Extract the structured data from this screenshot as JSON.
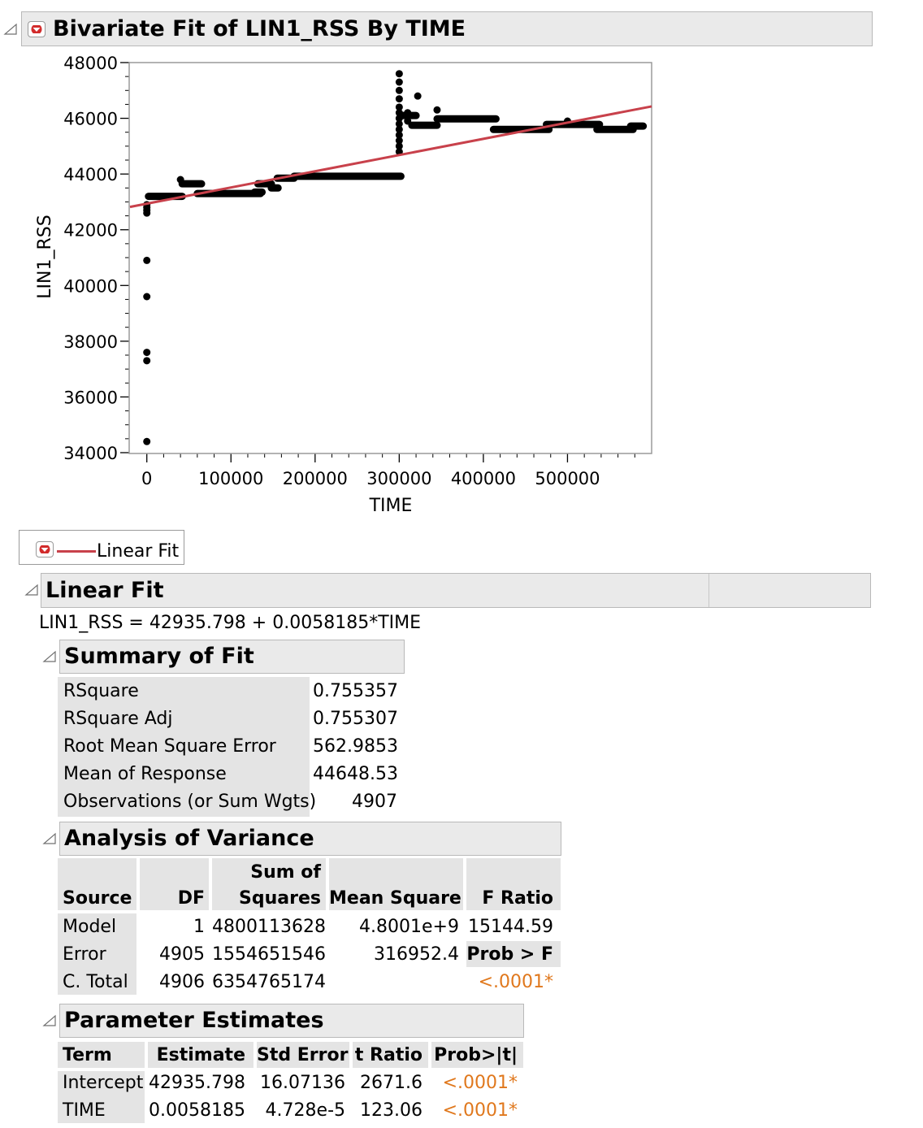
{
  "report": {
    "title": "Bivariate Fit of LIN1_RSS By TIME"
  },
  "chart_data": {
    "type": "scatter",
    "xlabel": "TIME",
    "ylabel": "LIN1_RSS",
    "xlim": [
      -20000,
      600000
    ],
    "ylim": [
      34000,
      48000
    ],
    "x_ticks": [
      "0",
      "100000",
      "200000",
      "300000",
      "400000",
      "500000"
    ],
    "y_ticks": [
      "34000",
      "36000",
      "38000",
      "40000",
      "42000",
      "44000",
      "46000",
      "48000"
    ],
    "fit_line": {
      "name": "Linear Fit",
      "intercept": 42935.798,
      "slope": 0.0058185,
      "color": "#c8414b"
    },
    "point_color": "#000000",
    "outlier_points": [
      {
        "x": 0,
        "y": 34400
      },
      {
        "x": 0,
        "y": 37300
      },
      {
        "x": 0,
        "y": 37600
      },
      {
        "x": 0,
        "y": 39600
      },
      {
        "x": 0,
        "y": 40900
      },
      {
        "x": 0,
        "y": 42600
      },
      {
        "x": 0,
        "y": 42700
      },
      {
        "x": 0,
        "y": 42800
      },
      {
        "x": 0,
        "y": 42900
      },
      {
        "x": 40000,
        "y": 43800
      },
      {
        "x": 300000,
        "y": 44800
      },
      {
        "x": 300000,
        "y": 45000
      },
      {
        "x": 300000,
        "y": 45200
      },
      {
        "x": 300000,
        "y": 45400
      },
      {
        "x": 300000,
        "y": 45600
      },
      {
        "x": 300000,
        "y": 45800
      },
      {
        "x": 300000,
        "y": 46000
      },
      {
        "x": 300000,
        "y": 46200
      },
      {
        "x": 300000,
        "y": 46400
      },
      {
        "x": 300000,
        "y": 46700
      },
      {
        "x": 300000,
        "y": 47000
      },
      {
        "x": 300000,
        "y": 47300
      },
      {
        "x": 300000,
        "y": 47600
      },
      {
        "x": 310000,
        "y": 46200
      },
      {
        "x": 310000,
        "y": 45900
      },
      {
        "x": 322000,
        "y": 46800
      },
      {
        "x": 345000,
        "y": 46300
      },
      {
        "x": 500000,
        "y": 45900
      }
    ],
    "segments": [
      {
        "x0": 2000,
        "x1": 42000,
        "y": 43200
      },
      {
        "x0": 42000,
        "x1": 65000,
        "y": 43650
      },
      {
        "x0": 60000,
        "x1": 135000,
        "y": 43300
      },
      {
        "x0": 128000,
        "x1": 137000,
        "y": 43350
      },
      {
        "x0": 132000,
        "x1": 148000,
        "y": 43650
      },
      {
        "x0": 148000,
        "x1": 156000,
        "y": 43500
      },
      {
        "x0": 155000,
        "x1": 175000,
        "y": 43850
      },
      {
        "x0": 175000,
        "x1": 302000,
        "y": 43920
      },
      {
        "x0": 302000,
        "x1": 320000,
        "y": 46100
      },
      {
        "x0": 315000,
        "x1": 345000,
        "y": 45750
      },
      {
        "x0": 345000,
        "x1": 415000,
        "y": 45980
      },
      {
        "x0": 412000,
        "x1": 478000,
        "y": 45600
      },
      {
        "x0": 475000,
        "x1": 538000,
        "y": 45780
      },
      {
        "x0": 535000,
        "x1": 578000,
        "y": 45600
      },
      {
        "x0": 575000,
        "x1": 590000,
        "y": 45720
      }
    ]
  },
  "legend": {
    "label": "Linear Fit"
  },
  "linear_fit": {
    "title": "Linear Fit",
    "equation": "LIN1_RSS = 42935.798 + 0.0058185*TIME"
  },
  "summary": {
    "title": "Summary of Fit",
    "rows": [
      {
        "label": "RSquare",
        "value": "0.755357"
      },
      {
        "label": "RSquare Adj",
        "value": "0.755307"
      },
      {
        "label": "Root Mean Square Error",
        "value": "562.9853"
      },
      {
        "label": "Mean of Response",
        "value": "44648.53"
      },
      {
        "label": "Observations (or Sum Wgts)",
        "value": "4907"
      }
    ]
  },
  "anova": {
    "title": "Analysis of Variance",
    "headers": {
      "source": "Source",
      "df": "DF",
      "ss_top": "Sum of",
      "ss_bottom": "Squares",
      "ms": "Mean Square",
      "f": "F Ratio",
      "prob": "Prob > F"
    },
    "rows": [
      {
        "source": "Model",
        "df": "1",
        "ss": "4800113628",
        "ms": "4.8001e+9",
        "extra": "15144.59"
      },
      {
        "source": "Error",
        "df": "4905",
        "ss": "1554651546",
        "ms": "316952.4"
      },
      {
        "source": "C. Total",
        "df": "4906",
        "ss": "6354765174",
        "ms": "",
        "extra": "<.0001*"
      }
    ]
  },
  "params": {
    "title": "Parameter Estimates",
    "headers": {
      "term": "Term",
      "est": "Estimate",
      "se": "Std Error",
      "t": "t Ratio",
      "p": "Prob>|t|"
    },
    "rows": [
      {
        "term": "Intercept",
        "est": "42935.798",
        "se": "16.07136",
        "t": "2671.6",
        "p": "<.0001*"
      },
      {
        "term": "TIME",
        "est": "0.0058185",
        "se": "4.728e-5",
        "t": "123.06",
        "p": "<.0001*"
      }
    ]
  }
}
